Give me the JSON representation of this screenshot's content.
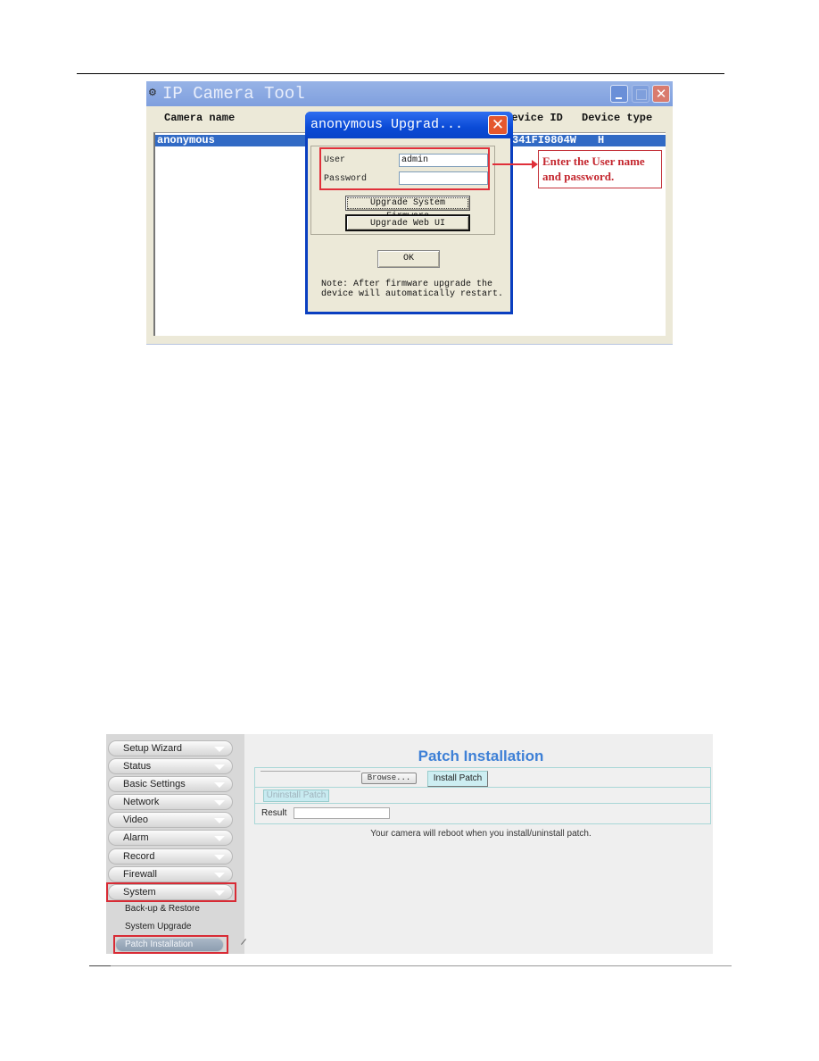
{
  "ip_camera_tool": {
    "title": "IP Camera Tool",
    "app_icon": "camera-tool-icon",
    "window_controls": {
      "minimize": "_",
      "maximize": "□",
      "close": "✕"
    },
    "columns": [
      "Camera name",
      "Device ID",
      "Device type"
    ],
    "rows": [
      {
        "camera_name": "anonymous",
        "device_id": "341FI9804W",
        "device_type": "H",
        "selected": true
      }
    ]
  },
  "upgrade_dialog": {
    "title": "anonymous Upgrad...",
    "close_glyph": "✕",
    "user_label": "User",
    "user_value": "admin",
    "password_label": "Password",
    "password_value": "",
    "upgrade_firmware_label": "Upgrade System Firmware",
    "upgrade_webui_label": "Upgrade Web UI",
    "ok_label": "OK",
    "note": "Note: After firmware upgrade the\ndevice will automatically restart."
  },
  "callout": {
    "text": "Enter the User name and password.",
    "color": "#c4262e"
  },
  "web_ui": {
    "nav_items": [
      {
        "label": "Setup Wizard"
      },
      {
        "label": "Status"
      },
      {
        "label": "Basic Settings"
      },
      {
        "label": "Network"
      },
      {
        "label": "Video"
      },
      {
        "label": "Alarm"
      },
      {
        "label": "Record"
      },
      {
        "label": "Firewall"
      },
      {
        "label": "System",
        "highlighted": true
      }
    ],
    "sub_items": [
      {
        "label": "Back-up & Restore"
      },
      {
        "label": "System Upgrade"
      },
      {
        "label": "Patch Installation",
        "active": true,
        "highlighted": true
      }
    ],
    "page_title": "Patch Installation",
    "browse_label": "Browse...",
    "install_patch_label": "Install Patch",
    "uninstall_patch_label": "Uninstall Patch",
    "result_label": "Result",
    "result_value": "",
    "reboot_note": "Your camera will reboot when you install/uninstall patch.",
    "title_color": "#3e80d6",
    "highlight_color": "#d82b35"
  }
}
